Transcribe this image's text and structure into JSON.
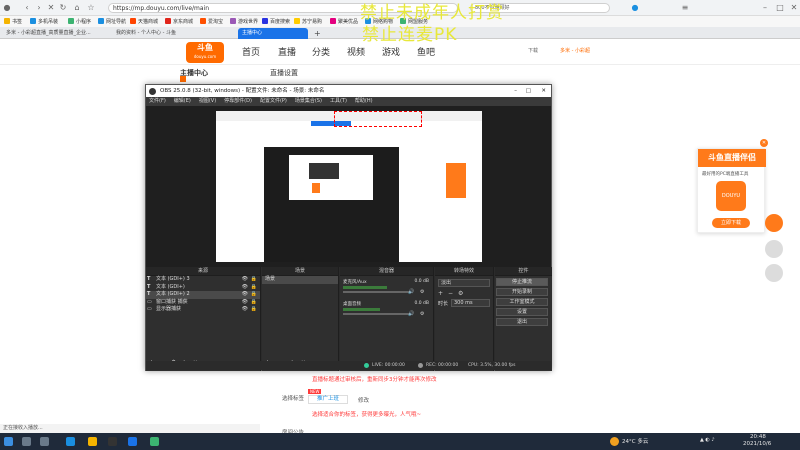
{
  "browser": {
    "url": "https://mp.douyu.com/live/main",
    "search_text": "800不惧雅顾好",
    "bookmarks": [
      "书签",
      "多机吊装",
      "小程序",
      "网址导航",
      "天猫商城",
      "京东商城",
      "爱淘宝",
      "游戏世界",
      "百度搜索",
      "苏宁易购",
      "聚美优品",
      "网络购物",
      "网盟服务"
    ],
    "tabs": [
      {
        "label": "多米 - 小彩超直播_高质量直播_企业..."
      },
      {
        "label": "我的资料 - 个人中心 - 斗鱼"
      },
      {
        "label": "主播中心"
      }
    ],
    "header_right_1": "下载",
    "header_right_2": "多米 - 小彩超"
  },
  "watermark": {
    "line1": "禁止未成年人打赏",
    "line2": "禁止连麦PK"
  },
  "site": {
    "logo_text": "斗鱼",
    "logo_sub": "douyu.com",
    "nav": [
      "首页",
      "直播",
      "分类",
      "视频",
      "游戏",
      "鱼吧"
    ],
    "sidebar_title": "主播中心",
    "section_title": "直播设置",
    "note_red_1": "直播标题通过审核后，重新同步3分钟才能再次修改",
    "tag_label": "选择标签",
    "tag_badge": "NEW",
    "tag_link": "推广上班",
    "tag_change": "修改",
    "note_red_2": "选择适合你的标签，获得更多曝光，人气哦~",
    "field_label": "房间公告"
  },
  "obs": {
    "title": "OBS 25.0.8 (32-bit, windows) - 配置文件: 未命名 - 场景: 未命名",
    "menu": [
      "文件(F)",
      "编辑(E)",
      "视图(V)",
      "停靠部件(D)",
      "配置文件(P)",
      "场景集合(S)",
      "工具(T)",
      "帮助(H)"
    ],
    "docks": {
      "sources": "来源",
      "scenes": "场景",
      "mixer": "混音器",
      "transitions": "转场特效",
      "controls": "控件"
    },
    "sources": [
      {
        "label": "文本 (GDI+) 3",
        "type": "text"
      },
      {
        "label": "文本 (GDI+)",
        "type": "text"
      },
      {
        "label": "文本 (GDI+) 2",
        "type": "text"
      },
      {
        "label": "窗口捕获 捕获",
        "type": "window"
      },
      {
        "label": "显示器捕获",
        "type": "monitor"
      }
    ],
    "scenes": [
      {
        "label": "场景"
      }
    ],
    "mixer": [
      {
        "name": "麦克风/Aux",
        "level": "0.0 dB",
        "level_fraction": 0.65
      },
      {
        "name": "桌面音频",
        "level": "0.0 dB",
        "level_fraction": 0.55
      }
    ],
    "transition": {
      "value": "淡出",
      "duration_label": "时长",
      "duration": "300 ms"
    },
    "controls": [
      "停止推流",
      "开始录制",
      "工作室模式",
      "设置",
      "退出"
    ],
    "status": {
      "live": "LIVE: 00:00:00",
      "rec": "REC: 00:00:00",
      "cpu": "CPU: 3.5%, 30.00 fps"
    }
  },
  "float_card": {
    "title": "斗鱼直播伴侣",
    "subtitle": "最好用的PC端直播工具",
    "button": "立即下载",
    "icon_text": "DOUYU"
  },
  "statusbar": {
    "text": "正在接收入播放..."
  },
  "taskbar": {
    "weather": "24°C 多云",
    "time": "20:48",
    "date": "2021/10/6"
  }
}
